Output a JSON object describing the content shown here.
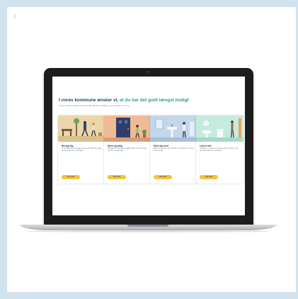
{
  "hero": {
    "title_prefix": "I vores kommune ønsker vi,",
    "title_accent": "at du har det godt længst muligt",
    "subtitle": "Læs om, hvordan vi hjælper dig med at klare dig selv i hverdagen, og om de tilbud vi har til dig"
  },
  "cards": [
    {
      "title": "Bevæg dig",
      "text": "Vi har tilbud der kan hjælpe dig med at holde dig i gang og styrke din krop i hverdagen.",
      "button": "Læs mere",
      "illustration": "walking-person"
    },
    {
      "title": "Hjem og bolig",
      "text": "Få hjælp til indretning og hjælpemidler, så du kan klare dig selv i dit eget hjem.",
      "button": "Læs mere",
      "illustration": "door-plant"
    },
    {
      "title": "Hold dig sund",
      "text": "Råd om kost, søvn og sundhed, der kan gøre en forskel i din hverdag.",
      "button": "Læs mere",
      "illustration": "washbasin"
    },
    {
      "title": "Lad os tale",
      "text": "Vi tilbyder en samtale om dine ønsker og behov, så vi sammen finder den rette hjælp.",
      "button": "Læs mere",
      "illustration": "bathroom-person"
    }
  ],
  "colors": {
    "background": "#cfe4ee",
    "title": "#1f3d5c",
    "accent": "#2e9b8d",
    "button": "#f5c33b",
    "card1": "#e9d6ab",
    "card2": "#f0ba95",
    "card3": "#c2d6ec",
    "card4": "#c5ebe0"
  }
}
